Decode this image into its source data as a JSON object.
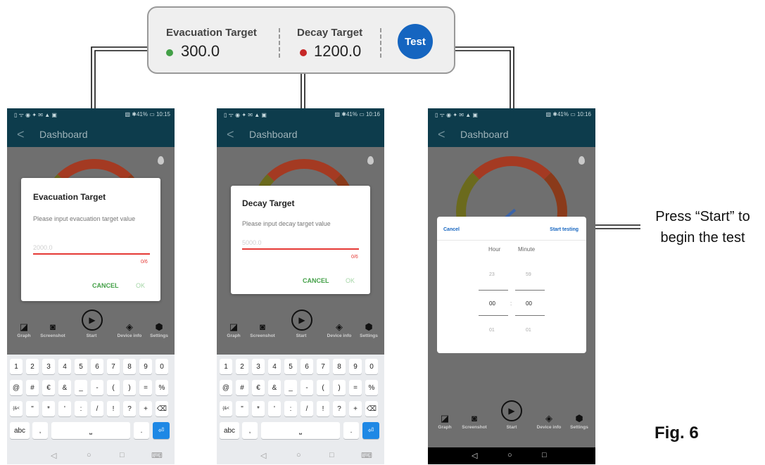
{
  "top_card": {
    "evac_label": "Evacuation Target",
    "evac_value": "300.0",
    "decay_label": "Decay Target",
    "decay_value": "1200.0",
    "test_label": "Test",
    "green_dot": "#43a047",
    "red_dot": "#c62828",
    "test_color": "#1565c0"
  },
  "status": {
    "left_icons": "▯ ᯤ ◉ ✦ ✉ ▲ ▣",
    "phone1_right": "▧ ✱41% ▭ 10:15",
    "phone2_right": "▧ ✱41% ▭ 10:16",
    "phone3_right": "▧ ✱41% ▭ 10:16"
  },
  "appbar": {
    "back": "<",
    "title": "Dashboard"
  },
  "toolbar": {
    "graph": "Graph",
    "screenshot": "Screenshot",
    "start": "Start",
    "device_info": "Device info",
    "settings": "Settings"
  },
  "dialog_evac": {
    "title": "Evacuation Target",
    "prompt": "Please input evacuation target value",
    "placeholder": "2000.0",
    "counter": "0/6",
    "cancel": "CANCEL",
    "ok": "OK"
  },
  "dialog_decay": {
    "title": "Decay Target",
    "prompt": "Please input decay target value",
    "placeholder": "5000.0",
    "counter": "0/6",
    "cancel": "CANCEL",
    "ok": "OK"
  },
  "keyboard": {
    "row1": [
      "1",
      "2",
      "3",
      "4",
      "5",
      "6",
      "7",
      "8",
      "9",
      "0"
    ],
    "row2": [
      "@",
      "#",
      "€",
      "&",
      "_",
      "-",
      "(",
      ")",
      "=",
      "%"
    ],
    "row3": [
      "{&<",
      "\"",
      "*",
      "'",
      ":",
      "/",
      "!",
      "?",
      "+",
      "⌫"
    ],
    "abc": "abc",
    "comma": ",",
    "space": "⎵",
    "period": ".",
    "enter": "⏎"
  },
  "picker": {
    "cancel": "Cancel",
    "start_testing": "Start testing",
    "hour_label": "Hour",
    "minute_label": "Minute",
    "hour_prev": "23",
    "minute_prev": "59",
    "hour_sel": "00",
    "colon": ":",
    "minute_sel": "00",
    "hour_next": "01",
    "minute_next": "01"
  },
  "nav": {
    "back": "◁",
    "home": "○",
    "recent": "□",
    "kb": "⌨"
  },
  "caption": {
    "line1": "Press “Start” to",
    "line2": "begin the test"
  },
  "figure_label": "Fig. 6"
}
